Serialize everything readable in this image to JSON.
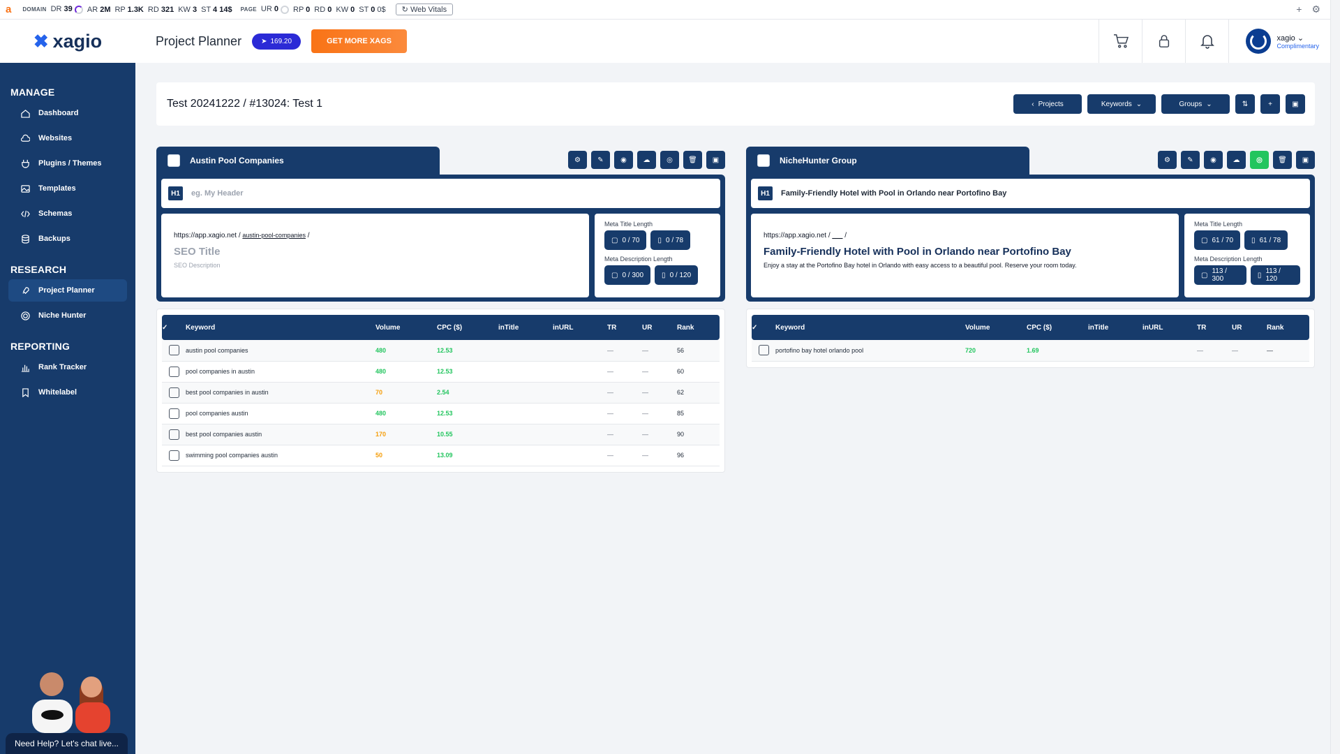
{
  "ext_bar": {
    "logo": "a",
    "domain_label": "DOMAIN",
    "dr_label": "DR",
    "dr": "39",
    "ar_label": "AR",
    "ar": "2M",
    "rp_label": "RP",
    "rp": "1.3K",
    "rd_label": "RD",
    "rd": "321",
    "kw_label": "KW",
    "kw": "3",
    "st_label": "ST",
    "st": "4",
    "st_usd": "14$",
    "page_label": "PAGE",
    "ur_label": "UR",
    "ur": "0",
    "prp_label": "RP",
    "prp": "0",
    "prd_label": "RD",
    "prd": "0",
    "pkw_label": "KW",
    "pkw": "0",
    "pst_label": "ST",
    "pst": "0",
    "pst_usd": "0$",
    "web_vitals": "Web Vitals"
  },
  "header": {
    "logo_text": "xagio",
    "page_title": "Project Planner",
    "xags_balance": "169.20",
    "get_more_label": "GET MORE XAGS",
    "user_name": "xagio",
    "user_plan": "Complimentary"
  },
  "sidebar": {
    "sections": [
      {
        "title": "MANAGE",
        "items": [
          {
            "label": "Dashboard",
            "icon": "home-icon"
          },
          {
            "label": "Websites",
            "icon": "cloud-icon"
          },
          {
            "label": "Plugins / Themes",
            "icon": "plug-icon"
          },
          {
            "label": "Templates",
            "icon": "image-icon"
          },
          {
            "label": "Schemas",
            "icon": "code-icon"
          },
          {
            "label": "Backups",
            "icon": "database-icon"
          }
        ]
      },
      {
        "title": "RESEARCH",
        "items": [
          {
            "label": "Project Planner",
            "icon": "rocket-icon",
            "active": true
          },
          {
            "label": "Niche Hunter",
            "icon": "target-icon"
          }
        ]
      },
      {
        "title": "REPORTING",
        "items": [
          {
            "label": "Rank Tracker",
            "icon": "bar-chart-icon"
          },
          {
            "label": "Whitelabel",
            "icon": "bookmark-icon"
          }
        ]
      }
    ],
    "chat_label": "Need Help? Let's chat live..."
  },
  "breadcrumb": {
    "text": "Test 20241222 / #13024: Test 1",
    "projects_label": "Projects",
    "keywords_label": "Keywords",
    "groups_label": "Groups"
  },
  "groups": [
    {
      "name": "Austin Pool Companies",
      "h1_placeholder": "eg. My Header",
      "h1_value": "",
      "url_base": "https://app.xagio.net /",
      "url_slug": "austin-pool-companies",
      "url_end": "/",
      "seo_title": "SEO Title",
      "seo_description": "SEO Description",
      "meta_title_label": "Meta Title Length",
      "meta_title_desktop": "0 / 70",
      "meta_title_mobile": "0 / 78",
      "meta_desc_label": "Meta Description Length",
      "meta_desc_desktop": "0 / 300",
      "meta_desc_mobile": "0 / 120",
      "columns": [
        "Keyword",
        "Volume",
        "CPC ($)",
        "inTitle",
        "inURL",
        "TR",
        "UR",
        "Rank"
      ],
      "rows": [
        {
          "keyword": "austin pool companies",
          "volume": "480",
          "vcolor": "green",
          "cpc": "12.53",
          "intitle": "",
          "inurl": "",
          "tr": "—",
          "ur": "—",
          "rank": "56"
        },
        {
          "keyword": "pool companies in austin",
          "volume": "480",
          "vcolor": "green",
          "cpc": "12.53",
          "intitle": "",
          "inurl": "",
          "tr": "—",
          "ur": "—",
          "rank": "60"
        },
        {
          "keyword": "best pool companies in austin",
          "volume": "70",
          "vcolor": "orange",
          "cpc": "2.54",
          "intitle": "",
          "inurl": "",
          "tr": "—",
          "ur": "—",
          "rank": "62"
        },
        {
          "keyword": "pool companies austin",
          "volume": "480",
          "vcolor": "green",
          "cpc": "12.53",
          "intitle": "",
          "inurl": "",
          "tr": "—",
          "ur": "—",
          "rank": "85"
        },
        {
          "keyword": "best pool companies austin",
          "volume": "170",
          "vcolor": "orange",
          "cpc": "10.55",
          "intitle": "",
          "inurl": "",
          "tr": "—",
          "ur": "—",
          "rank": "90"
        },
        {
          "keyword": "swimming pool companies austin",
          "volume": "50",
          "vcolor": "orange",
          "cpc": "13.09",
          "intitle": "",
          "inurl": "",
          "tr": "—",
          "ur": "—",
          "rank": "96"
        }
      ]
    },
    {
      "name": "NicheHunter Group",
      "h1_placeholder": "",
      "h1_value": "Family-Friendly Hotel with Pool in Orlando near Portofino Bay",
      "url_base": "https://app.xagio.net /",
      "url_slug": "___",
      "url_end": "/",
      "seo_title": "Family-Friendly Hotel with Pool in Orlando near Portofino Bay",
      "seo_description": "Enjoy a stay at the Portofino Bay hotel in Orlando with easy access to a beautiful pool. Reserve your room today.",
      "meta_title_label": "Meta Title Length",
      "meta_title_desktop": "61 / 70",
      "meta_title_mobile": "61 / 78",
      "meta_desc_label": "Meta Description Length",
      "meta_desc_desktop": "113 / 300",
      "meta_desc_mobile": "113 / 120",
      "columns": [
        "Keyword",
        "Volume",
        "CPC ($)",
        "inTitle",
        "inURL",
        "TR",
        "UR",
        "Rank"
      ],
      "rows": [
        {
          "keyword": "portofino bay hotel orlando pool",
          "volume": "720",
          "vcolor": "green",
          "cpc": "1.69",
          "intitle": "",
          "inurl": "",
          "tr": "—",
          "ur": "—",
          "rank": "—"
        }
      ]
    }
  ],
  "colors": {
    "navy": "#173b6b",
    "orange": "#f97316",
    "green": "#22c55e",
    "accent_blue": "#2b2ad6"
  }
}
